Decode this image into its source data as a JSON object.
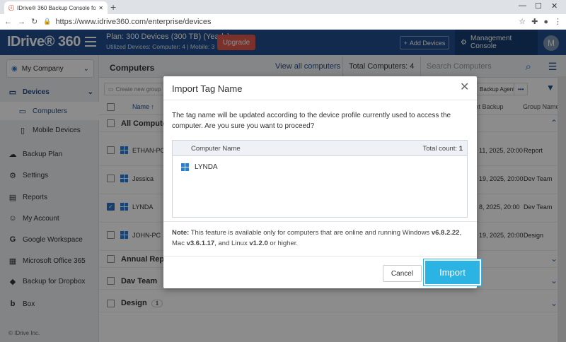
{
  "browser": {
    "tab_title": "IDrive® 360 Backup Console for",
    "url": "https://www.idrive360.com/enterprise/devices",
    "new_tab": "+"
  },
  "header": {
    "logo": "IDrive® 360",
    "plan": "Plan: 300 Devices (300 TB) (Yearly)",
    "utilized": "Utilized Devices: Computer: 4 |   Mobile: 3",
    "upgrade_label": "Upgrade",
    "add_devices_label": "Add Devices",
    "management_console_label": "Management Console",
    "avatar_letter": "M"
  },
  "sidebar": {
    "company": "My Company",
    "items": [
      {
        "label": "Devices",
        "icon": "devices-icon"
      },
      {
        "label": "Computers",
        "icon": "monitor-icon"
      },
      {
        "label": "Mobile Devices",
        "icon": "mobile-icon"
      },
      {
        "label": "Backup Plan",
        "icon": "backup-plan-icon"
      },
      {
        "label": "Settings",
        "icon": "gear-icon"
      },
      {
        "label": "Reports",
        "icon": "reports-icon"
      },
      {
        "label": "My Account",
        "icon": "user-icon"
      },
      {
        "label": "Google Workspace",
        "icon": "google-icon"
      },
      {
        "label": "Microsoft Office 365",
        "icon": "office-icon"
      },
      {
        "label": "Backup for Dropbox",
        "icon": "dropbox-icon"
      },
      {
        "label": "Box",
        "icon": "box-icon"
      }
    ],
    "copyright": "© IDrive Inc."
  },
  "main": {
    "title": "Computers",
    "view_all": "View all computers",
    "total": "Total Computers: 4",
    "search_placeholder": "Search Computers",
    "create_group": "Create new group",
    "backup_agent": "Backup Agent",
    "more": "•••",
    "col_name": "Name",
    "col_sort": "↑",
    "col_last_backup": "xt Backup",
    "col_group": "Group Name",
    "all_computers": "All Computers",
    "rows": [
      {
        "name": "ETHAN-PC",
        "last_backup": "11, 2025, 20:00",
        "group": "Report",
        "checked": false
      },
      {
        "name": "Jessica",
        "last_backup": "19, 2025, 20:00",
        "group": "Dev Team",
        "checked": false
      },
      {
        "name": "LYNDA",
        "last_backup": "8, 2025, 20:00",
        "group": "Dev Team",
        "checked": true
      },
      {
        "name": "JOHN-PC",
        "last_backup": "19, 2025, 20:00",
        "group": "Design",
        "checked": false
      }
    ],
    "groups": [
      {
        "name": "Annual Repo",
        "count": ""
      },
      {
        "name": "Dav Team",
        "count": ""
      },
      {
        "name": "Design",
        "count": "1"
      }
    ]
  },
  "dialog": {
    "title": "Import Tag Name",
    "message": "The tag name will be updated according to the device profile currently used to access the computer. Are you sure you want to proceed?",
    "table_header": "Computer Name",
    "total_count_label": "Total count:",
    "total_count_value": "1",
    "computers": [
      "LYNDA"
    ],
    "note_label": "Note:",
    "note_text": " This feature is available only for computers that are online and running Windows ",
    "note_win": "v6.8.2.22",
    "note_mid": ", Mac ",
    "note_mac": "v3.6.1.17",
    "note_and": ", and Linux ",
    "note_linux": "v1.2.0",
    "note_end": " or higher.",
    "cancel_label": "Cancel",
    "import_label": "Import"
  },
  "colors": {
    "header_bg": "#1f4e8c",
    "upgrade": "#e05a4b",
    "import": "#2ab3e3"
  }
}
